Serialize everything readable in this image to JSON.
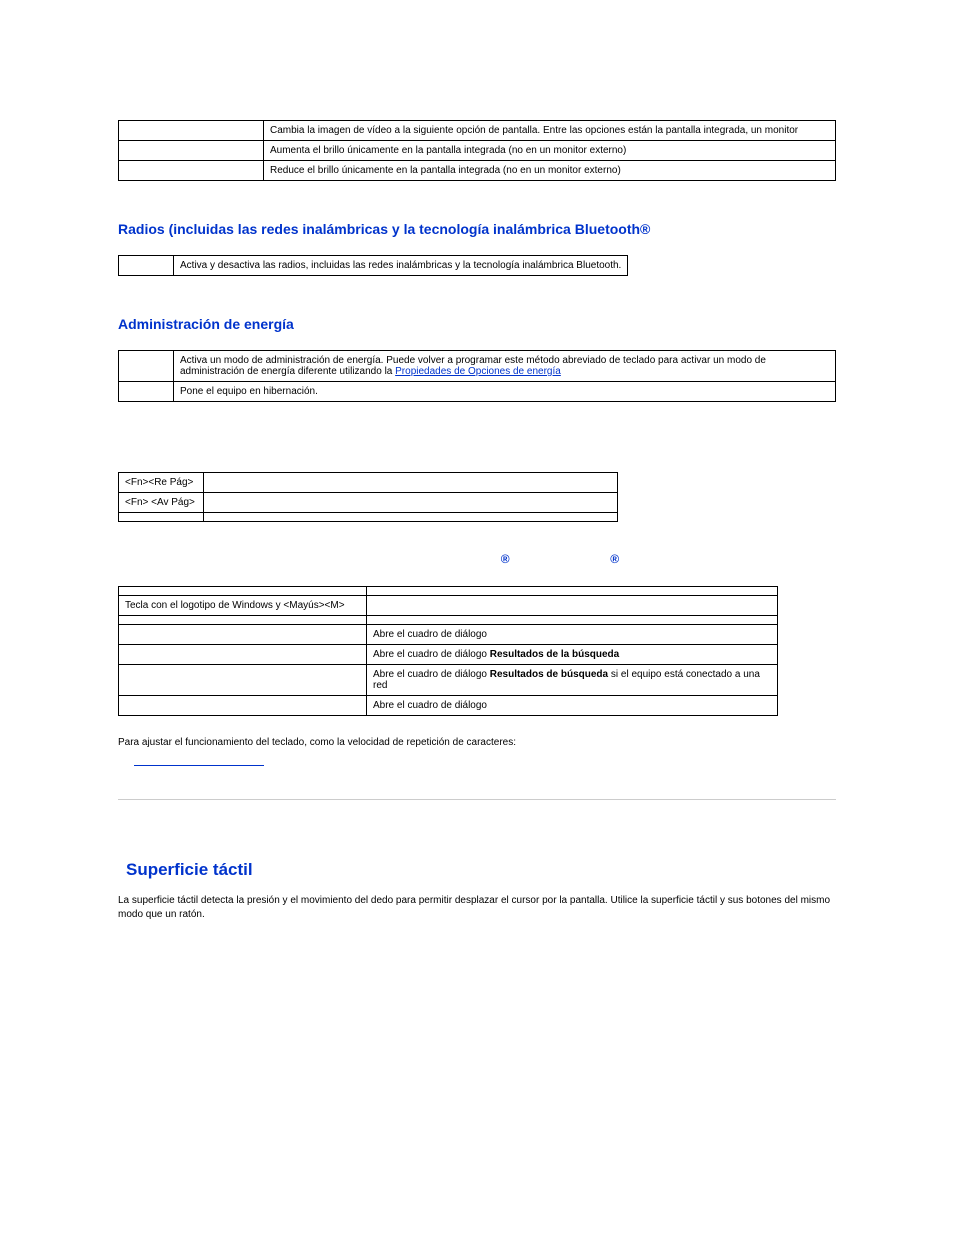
{
  "display_table": {
    "rows": [
      {
        "left": "",
        "right": "Cambia la imagen de vídeo a la siguiente opción de pantalla. Entre las opciones están la pantalla integrada, un monitor"
      },
      {
        "left": "",
        "right": "Aumenta el brillo únicamente en la pantalla integrada (no en un monitor externo)"
      },
      {
        "left": "",
        "right": "Reduce el brillo únicamente en la pantalla integrada (no en un monitor externo)"
      }
    ]
  },
  "radios": {
    "heading": "Radios (incluidas las redes inalámbricas y la tecnología inalámbrica Bluetooth®",
    "row": {
      "left": "",
      "right": "Activa y desactiva las radios, incluidas las redes inalámbricas y la tecnología inalámbrica Bluetooth."
    }
  },
  "power": {
    "heading": "Administración de energía",
    "rows": [
      {
        "left": "",
        "pre": "Activa un modo de administración de energía. Puede volver a programar este método abreviado de teclado para activar un modo de administración de energía diferente utilizando la ",
        "link": "Propiedades de Opciones de energía"
      },
      {
        "left": "",
        "right": "Pone el equipo en hibernación."
      }
    ]
  },
  "fn_table": {
    "rows": [
      {
        "left": "<Fn><Re Pág>",
        "right": ""
      },
      {
        "left": "<Fn> <Av Pág>",
        "right": ""
      },
      {
        "left": "",
        "right": ""
      }
    ]
  },
  "reg_symbols": {
    "a": "®",
    "b": "®"
  },
  "win_table": {
    "rows": [
      {
        "left": "",
        "right": ""
      },
      {
        "left": "Tecla con el logotipo de Windows y <Mayús><M>",
        "right": ""
      },
      {
        "left": "",
        "right": ""
      },
      {
        "left": "",
        "right_pre": "Abre el cuadro de diálogo ",
        "right_bold": "",
        "right_post": ""
      },
      {
        "left": "",
        "right_pre": "Abre el cuadro de diálogo ",
        "right_bold": "Resultados de la búsqueda",
        "right_post": ""
      },
      {
        "left": "",
        "right_pre": "Abre el cuadro de diálogo ",
        "right_bold": "Resultados de búsqueda",
        "right_post": " si el equipo está conectado a una red"
      },
      {
        "left": "",
        "right_pre": "Abre el cuadro de diálogo ",
        "right_bold": "",
        "right_post": ""
      }
    ]
  },
  "keyboard_note": "Para ajustar el funcionamiento del teclado, como la velocidad de repetición de caracteres:",
  "touchpad": {
    "heading": "Superficie táctil",
    "body": "La superficie táctil detecta la presión y el movimiento del dedo para permitir desplazar el cursor por la pantalla. Utilice la superficie táctil y sus botones del mismo modo que un ratón."
  }
}
